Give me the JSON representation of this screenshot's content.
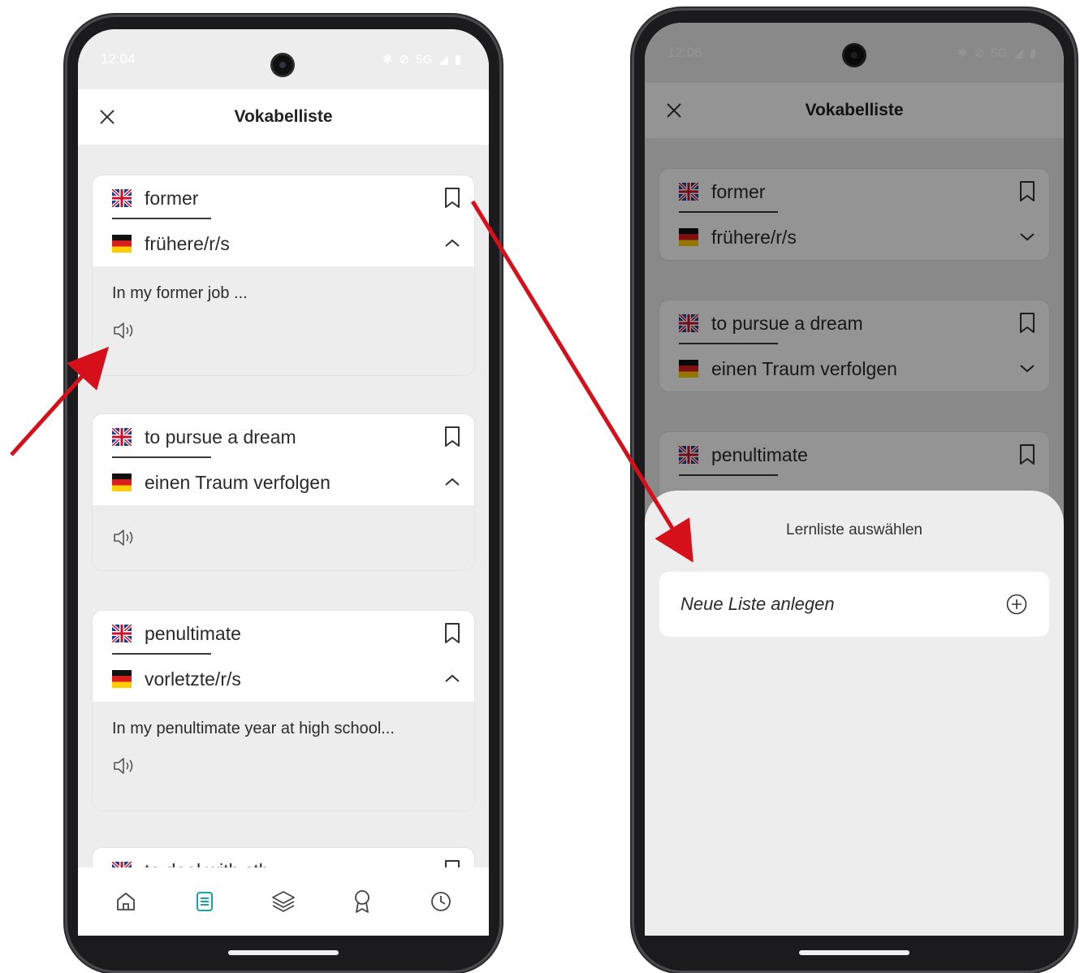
{
  "colors": {
    "accent_teal": "#1aa3a3",
    "arrow_red": "#d6101a",
    "card_bg": "#ffffff",
    "panel_bg": "#ededed"
  },
  "left_phone": {
    "status": {
      "time": "12:04",
      "network": "5G"
    },
    "header": {
      "title": "Vokabelliste",
      "close_icon": "close-icon"
    },
    "cards": [
      {
        "en": "former",
        "de": "frühere/r/s",
        "example": "In my former job ...",
        "expanded": true
      },
      {
        "en": "to pursue a dream",
        "de": "einen Traum verfolgen",
        "example": "",
        "expanded": true
      },
      {
        "en": "penultimate",
        "de": "vorletzte/r/s",
        "example": "In my penultimate year at high school...",
        "expanded": true
      },
      {
        "en": "to deal with sth.",
        "de": "",
        "example": "",
        "expanded": false
      }
    ],
    "bottom_nav": [
      "home-icon",
      "list-icon",
      "layers-icon",
      "award-icon",
      "clock-icon"
    ],
    "active_nav": "list-icon"
  },
  "right_phone": {
    "status": {
      "time": "12:06",
      "network": "5G"
    },
    "header": {
      "title": "Vokabelliste"
    },
    "cards": [
      {
        "en": "former",
        "de": "frühere/r/s"
      },
      {
        "en": "to pursue a dream",
        "de": "einen Traum verfolgen"
      },
      {
        "en": "penultimate",
        "de": ""
      }
    ],
    "sheet": {
      "title": "Lernliste auswählen",
      "new_list_label": "Neue Liste anlegen",
      "new_list_icon": "plus-circle-icon"
    }
  }
}
